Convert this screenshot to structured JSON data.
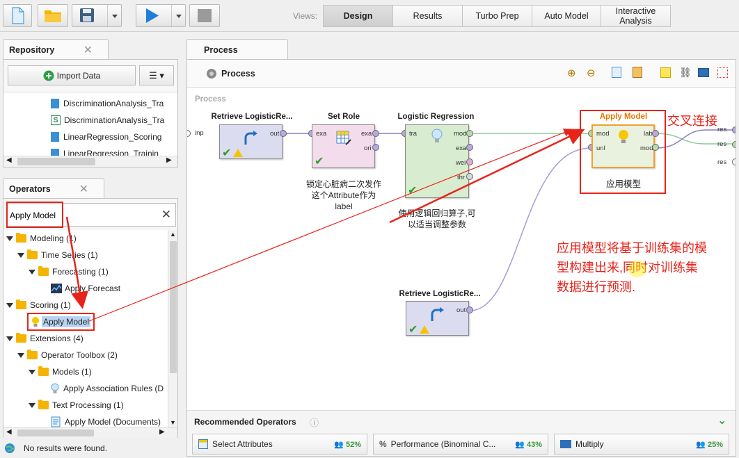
{
  "views": {
    "label": "Views:",
    "tabs": [
      "Design",
      "Results",
      "Turbo Prep",
      "Auto Model",
      "Interactive Analysis"
    ]
  },
  "repository": {
    "tab": "Repository",
    "import_label": "Import Data",
    "items": [
      "DiscriminationAnalysis_Tra",
      "DiscriminationAnalysis_Tra",
      "LinearRegression_Scoring",
      "LinearRegression_Trainin"
    ]
  },
  "operators": {
    "tab": "Operators",
    "search_value": "Apply Model",
    "tree": [
      "Modeling (1)",
      "Time Series (1)",
      "Forecasting (1)",
      "Apply Forecast",
      "Scoring (1)",
      "Apply Model",
      "Extensions (4)",
      "Operator Toolbox (2)",
      "Models (1)",
      "Apply Association Rules (D",
      "Text Processing (1)",
      "Apply Model (Documents)"
    ]
  },
  "status": {
    "text": "No results were found."
  },
  "process": {
    "tab": "Process",
    "header": "Process",
    "canvas_label": "Process",
    "operators": {
      "retrieve1": {
        "title": "Retrieve LogisticRe...",
        "ports": [
          "inp",
          "out"
        ]
      },
      "setrole": {
        "title": "Set Role",
        "ports": [
          "exa",
          "exa",
          "ori"
        ],
        "note": "锁定心脏病二次发作这个Attribute作为label"
      },
      "logreg": {
        "title": "Logistic Regression",
        "ports": [
          "tra",
          "mod",
          "exa",
          "wei",
          "thr"
        ],
        "note": "使用逻辑回归算子,可以适当调整参数"
      },
      "apply": {
        "title": "Apply Model",
        "ports": [
          "mod",
          "unl",
          "lab",
          "mod"
        ],
        "inner": "应用模型"
      },
      "retrieve2": {
        "title": "Retrieve LogisticRe...",
        "ports": [
          "out"
        ]
      }
    },
    "result_ports": [
      "res",
      "res",
      "res"
    ],
    "annotation_cross": "交叉连接",
    "annotation_main": "应用模型将基于训练集的模型构建出来,同时对训练集数据进行预测."
  },
  "recommended": {
    "title": "Recommended Operators",
    "items": [
      {
        "label": "Select Attributes",
        "pct": "52%"
      },
      {
        "label": "Performance (Binominal C...",
        "pct": "43%"
      },
      {
        "label": "Multiply",
        "pct": "25%"
      }
    ]
  },
  "colors": {
    "accent_red": "#e8231a",
    "run_blue": "#1f7fd6",
    "apply_orange": "#e07800"
  }
}
